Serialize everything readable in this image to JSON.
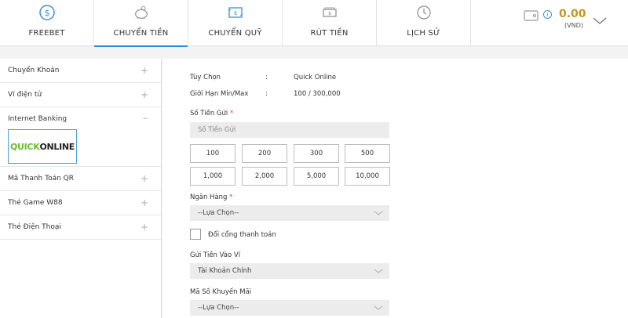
{
  "tabs": [
    {
      "label": "FREEBET",
      "icon": "dollar-coin-icon"
    },
    {
      "label": "CHUYỂN TIỀN",
      "icon": "piggy-bank-icon"
    },
    {
      "label": "CHUYỂN QUỸ",
      "icon": "transfer-icon"
    },
    {
      "label": "RÚT TIỀN",
      "icon": "cash-icon"
    },
    {
      "label": "LỊCH SỬ",
      "icon": "history-icon"
    }
  ],
  "active_tab": 1,
  "wallet": {
    "amount": "0.00",
    "currency": "(VND)",
    "info": "i"
  },
  "sidebar": {
    "items_top": [
      {
        "label": "Chuyển Khoản",
        "sign": "+"
      },
      {
        "label": "Ví điện tử",
        "sign": "+"
      }
    ],
    "expanded": {
      "label": "Internet Banking",
      "sign": "−",
      "logo_q": "QUICK",
      "logo_o": "ONLINE"
    },
    "items_bottom": [
      {
        "label": "Mã Thanh Toán QR",
        "sign": "+"
      },
      {
        "label": "Thẻ Game W88",
        "sign": "+"
      },
      {
        "label": "Thẻ Điện Thoại",
        "sign": "+"
      }
    ]
  },
  "form": {
    "option_label": "Tùy Chọn",
    "option_sep": ":",
    "option_value": "Quick Online",
    "limit_label": "Giới Hạn Min/Max",
    "limit_sep": ":",
    "limit_value": "100 / 300,000",
    "amount_label": "Số Tiền Gửi",
    "required": "*",
    "amount_placeholder": "Số Tiền Gửi",
    "amount_buttons": [
      "100",
      "200",
      "300",
      "500",
      "1,000",
      "2,000",
      "5,000",
      "10,000"
    ],
    "bank_label": "Ngân Hàng",
    "bank_value": "--Lựa Chọn--",
    "switch_gateway_label": "Đổi cổng thanh toán",
    "wallet_label": "Gửi Tiền Vào Ví",
    "wallet_value": "Tài Khoản Chính",
    "promo_label": "Mã Số Khuyến Mãi",
    "promo_value": "--Lựa Chọn--"
  },
  "colors": {
    "accent": "#2a8ad6",
    "amount": "#c8961e",
    "required": "#e53935"
  }
}
